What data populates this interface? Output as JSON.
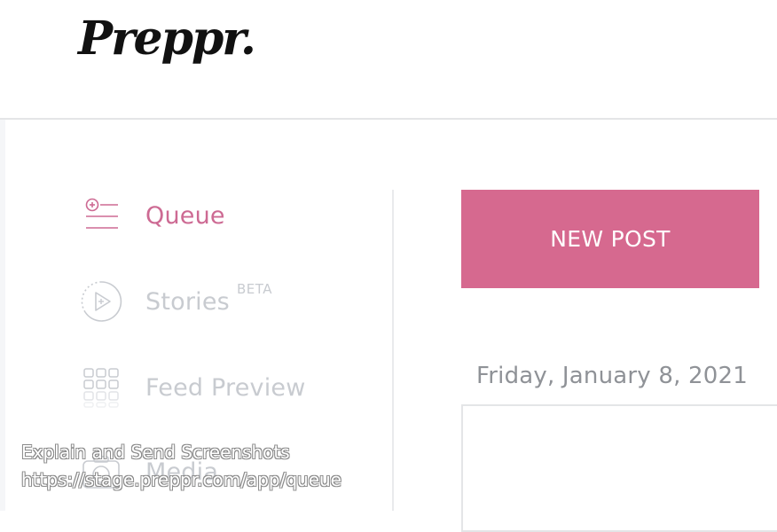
{
  "header": {
    "logo_text": "Preppr."
  },
  "sidebar": {
    "items": [
      {
        "label": "Queue",
        "icon": "queue-icon",
        "active": true
      },
      {
        "label": "Stories",
        "badge": "BETA",
        "icon": "stories-play-icon",
        "active": false
      },
      {
        "label": "Feed Preview",
        "icon": "grid-icon",
        "active": false
      },
      {
        "label": "Media",
        "icon": "camera-icon",
        "active": false
      }
    ]
  },
  "main": {
    "new_post_label": "NEW POST",
    "date_heading": "Friday, January 8, 2021"
  },
  "overlay": {
    "line1": "Explain and Send Screenshots",
    "line2": "https://stage.preppr.com/app/queue"
  },
  "colors": {
    "accent": "#d6698f",
    "active_text": "#cd6a93",
    "inactive_text": "#c8cbd0"
  }
}
